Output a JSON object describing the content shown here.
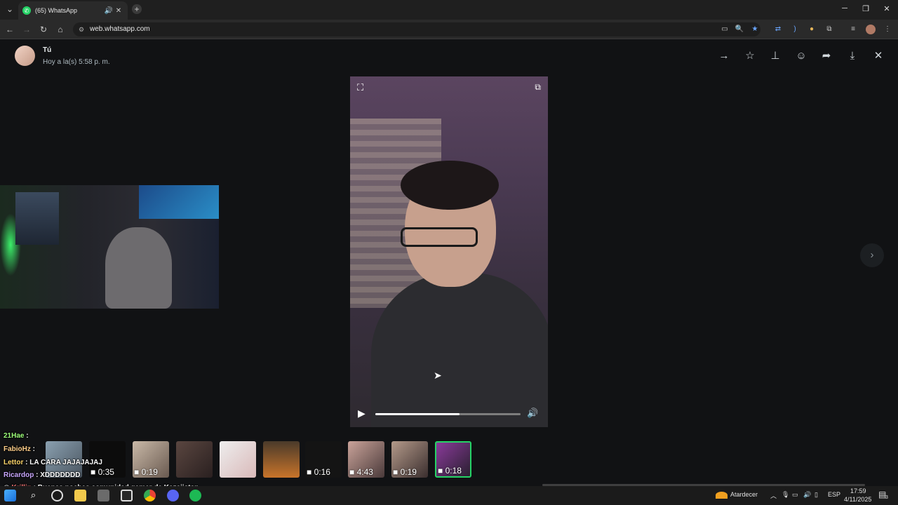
{
  "browser": {
    "tab_title": "(65) WhatsApp",
    "url": "web.whatsapp.com"
  },
  "viewer": {
    "sender": "Tú",
    "timestamp": "Hoy a la(s) 5:58 p. m.",
    "video_progress": 0.58
  },
  "thumbnails": [
    {
      "duration": ""
    },
    {
      "duration": "0:35"
    },
    {
      "duration": "0:19"
    },
    {
      "duration": ""
    },
    {
      "duration": ""
    },
    {
      "duration": ""
    },
    {
      "duration": "0:16"
    },
    {
      "duration": "4:43"
    },
    {
      "duration": "0:19"
    },
    {
      "duration": "0:18"
    }
  ],
  "chat": [
    {
      "user": "21Hae",
      "text": ""
    },
    {
      "user": "FabioHz",
      "text": ""
    },
    {
      "user": "Lettor",
      "text": "LA CARA JAJAJAJAJ"
    },
    {
      "user": "Ricardop",
      "text": "XDDDDDDD"
    },
    {
      "user": "Krillin",
      "text": "Buenas noches comunidad gamer de Kazajistan"
    }
  ],
  "taskbar": {
    "weather": "Atardecer",
    "language": "ESP",
    "time": "17:59",
    "date": "4/11/2025",
    "notifications": "3"
  },
  "colors": {
    "accent": "#25d366",
    "background": "#111214"
  }
}
